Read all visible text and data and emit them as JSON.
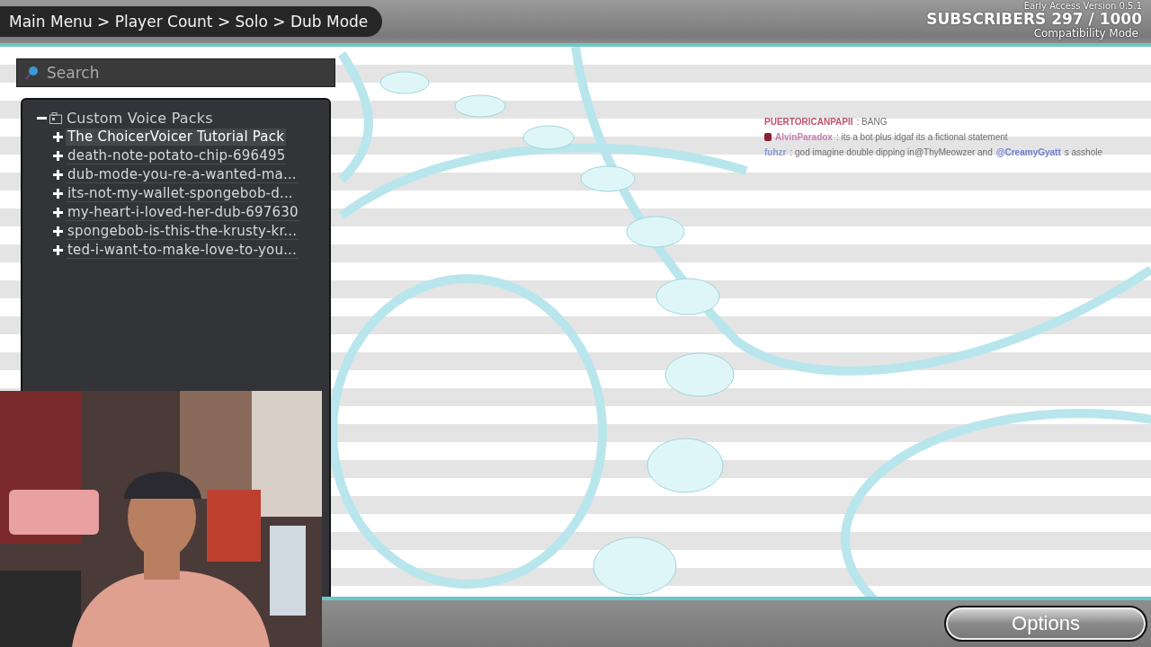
{
  "breadcrumb": "Main Menu > Player Count > Solo > Dub Mode",
  "overlay": {
    "version": "Early Access Version 0.5.1",
    "subscribers": "SUBSCRIBERS 297 / 1000",
    "mode": "Compatibility Mode"
  },
  "search": {
    "placeholder": "Search"
  },
  "tree": {
    "label": "Custom Voice Packs",
    "expanded": true,
    "children": [
      {
        "label": "The ChoicerVoicer Tutorial Pack",
        "expanded": false,
        "selected": true
      },
      {
        "label": "death-note-potato-chip-696495",
        "expanded": false,
        "selected": false
      },
      {
        "label": "dub-mode-you-re-a-wanted-ma...",
        "expanded": false,
        "selected": false
      },
      {
        "label": "its-not-my-wallet-spongebob-d...",
        "expanded": false,
        "selected": false
      },
      {
        "label": "my-heart-i-loved-her-dub-697630",
        "expanded": false,
        "selected": false
      },
      {
        "label": "spongebob-is-this-the-krusty-kr...",
        "expanded": false,
        "selected": false
      },
      {
        "label": "ted-i-want-to-make-love-to-you...",
        "expanded": false,
        "selected": false
      }
    ]
  },
  "chat": [
    {
      "user": "PUERTORICANPAPII",
      "color": "#c0506a",
      "badge": false,
      "parts": [
        {
          "kind": "text",
          "text": ": BANG"
        }
      ]
    },
    {
      "user": "AlvinParadox",
      "color": "#c880b0",
      "badge": true,
      "parts": [
        {
          "kind": "text",
          "text": ": its a bot plus idgaf its a fictional statement"
        }
      ]
    },
    {
      "user": "fuhzr",
      "color": "#8a9ad8",
      "badge": false,
      "parts": [
        {
          "kind": "text",
          "text": ": god imagine double dipping in@ThyMeowzer and"
        },
        {
          "kind": "mention",
          "text": "@CreamyGyatt"
        },
        {
          "kind": "text",
          "text": "s asshole"
        }
      ]
    }
  ],
  "options_button": "Options"
}
